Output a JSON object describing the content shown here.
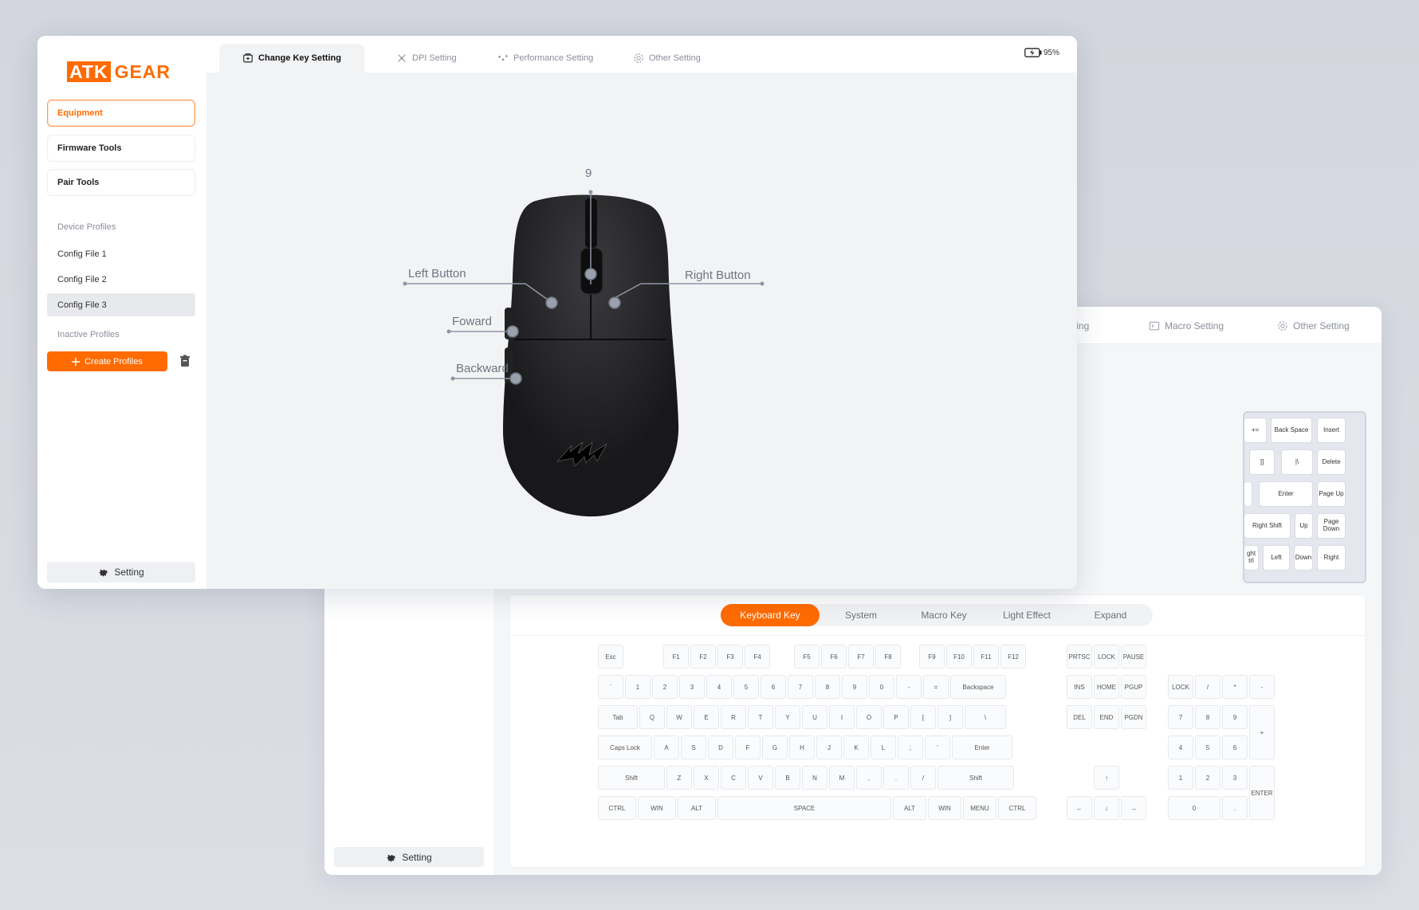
{
  "back_window": {
    "tabs": [
      {
        "label": "ting",
        "icon": "none"
      },
      {
        "label": "Macro Setting",
        "icon": "terminal-icon"
      },
      {
        "label": "Other Setting",
        "icon": "gear-icon"
      }
    ],
    "setting_label": "Setting",
    "mini_keyboard": [
      "+=",
      "Back Space",
      "Insert",
      "]]",
      "|\\",
      "Delete",
      "Enter",
      "Page Up",
      "Right Shift",
      "Up",
      "Page Down",
      "ght trl",
      "Left",
      "Down",
      "Right"
    ],
    "key_tabs": [
      {
        "label": "Keyboard Key",
        "active": true
      },
      {
        "label": "System",
        "active": false
      },
      {
        "label": "Macro Key",
        "active": false
      },
      {
        "label": "Light Effect",
        "active": false
      },
      {
        "label": "Expand",
        "active": false
      }
    ],
    "keyboard": {
      "row0": [
        "Esc",
        "F1",
        "F2",
        "F3",
        "F4",
        "F5",
        "F6",
        "F7",
        "F8",
        "F9",
        "F10",
        "F11",
        "F12",
        "PRTSC",
        "LOCK",
        "PAUSE"
      ],
      "row1": [
        "`",
        "1",
        "2",
        "3",
        "4",
        "5",
        "6",
        "7",
        "8",
        "9",
        "0",
        "-",
        "=",
        "Backspace",
        "INS",
        "HOME",
        "PGUP",
        "LOCK",
        "/",
        "*",
        "-"
      ],
      "row2": [
        "Tab",
        "Q",
        "W",
        "E",
        "R",
        "T",
        "Y",
        "U",
        "I",
        "O",
        "P",
        "[",
        "]",
        "\\",
        "DEL",
        "END",
        "PGDN",
        "7",
        "8",
        "9",
        "+"
      ],
      "row3": [
        "Caps Lock",
        "A",
        "S",
        "D",
        "F",
        "G",
        "H",
        "J",
        "K",
        "L",
        ";",
        "'",
        "Enter",
        "4",
        "5",
        "6"
      ],
      "row4": [
        "Shift",
        "Z",
        "X",
        "C",
        "V",
        "B",
        "N",
        "M",
        ",",
        ".",
        "/",
        "Shift",
        "↑",
        "1",
        "2",
        "3",
        "ENTER"
      ],
      "row5": [
        "CTRL",
        "WIN",
        "ALT",
        "SPACE",
        "ALT",
        "WIN",
        "MENU",
        "CTRL",
        "←",
        "↓",
        "→",
        "0",
        "."
      ]
    }
  },
  "front_window": {
    "logo": {
      "part1": "ATK",
      "part2": "GEAR"
    },
    "nav": [
      {
        "label": "Equipment",
        "active": true
      },
      {
        "label": "Firmware Tools",
        "active": false
      },
      {
        "label": "Pair Tools",
        "active": false
      }
    ],
    "device_profiles_label": "Device Profiles",
    "configs": [
      {
        "label": "Config File 1",
        "active": false
      },
      {
        "label": "Config File 2",
        "active": false
      },
      {
        "label": "Config File 3",
        "active": true
      }
    ],
    "inactive_profiles_label": "Inactive Profiles",
    "create_profiles_label": "Create Profiles",
    "setting_label": "Setting",
    "tabs": [
      {
        "label": "Change Key Setting",
        "icon": "key-setting-icon",
        "active": true
      },
      {
        "label": "DPI Setting",
        "icon": "dpi-icon",
        "active": false
      },
      {
        "label": "Performance Setting",
        "icon": "performance-icon",
        "active": false
      },
      {
        "label": "Other Setting",
        "icon": "gear-icon",
        "active": false
      }
    ],
    "battery": "95%",
    "mouse_buttons": {
      "scroll": "9",
      "left": "Left Button",
      "right": "Right Button",
      "forward": "Foward",
      "backward": "Backward"
    }
  },
  "colors": {
    "accent": "#ff6b00",
    "mouse_body": "#1c1c1e"
  }
}
